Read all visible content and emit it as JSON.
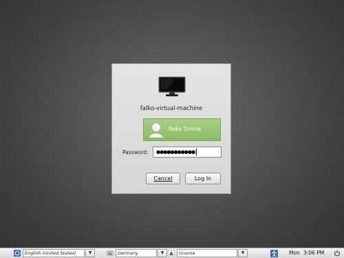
{
  "login": {
    "hostname": "falko-virtual-machine",
    "user": "Falko Timme",
    "password_label": "Password:",
    "password_value": "●●●●●●●●●●●",
    "cancel_label": "Cancel",
    "login_label": "Log In"
  },
  "taskbar": {
    "language": "English (United States)",
    "keyboard": "Germany",
    "session": "Gnome",
    "day": "Mon",
    "time": "3:06 PM",
    "dropdown_glyph": "▼"
  },
  "icons": {
    "computer": "monitor-icon",
    "avatar": "user-avatar-icon",
    "language": "language-icon",
    "keyboard": "keyboard-icon",
    "session": "session-icon",
    "accessibility": "accessibility-icon",
    "power": "power-icon"
  },
  "colors": {
    "user_row": "#9bc672",
    "taskbar": "#e6e6e6"
  }
}
